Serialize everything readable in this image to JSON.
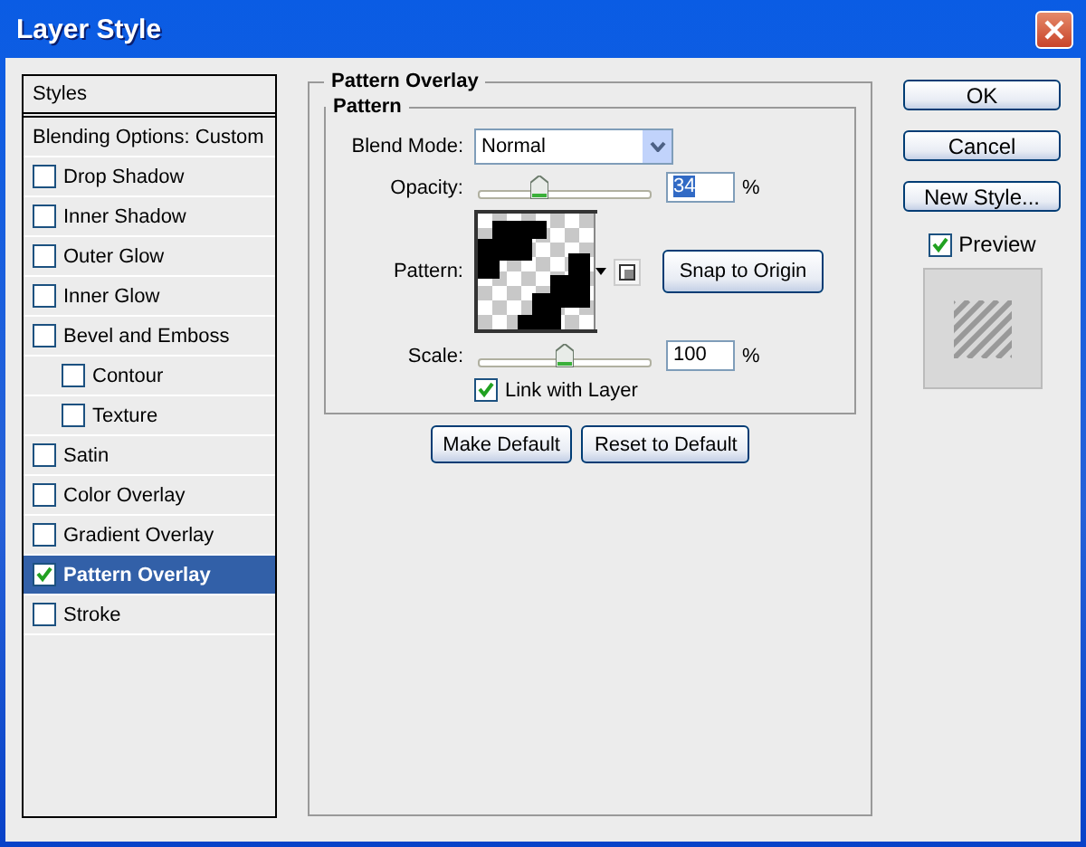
{
  "window": {
    "title": "Layer Style"
  },
  "styles_list": {
    "header": "Styles",
    "blending": "Blending Options: Custom",
    "items": [
      {
        "label": "Drop Shadow",
        "checked": false,
        "selected": false
      },
      {
        "label": "Inner Shadow",
        "checked": false,
        "selected": false
      },
      {
        "label": "Outer Glow",
        "checked": false,
        "selected": false
      },
      {
        "label": "Inner Glow",
        "checked": false,
        "selected": false
      },
      {
        "label": "Bevel and Emboss",
        "checked": false,
        "selected": false,
        "children": [
          {
            "label": "Contour",
            "checked": false,
            "selected": false
          },
          {
            "label": "Texture",
            "checked": false,
            "selected": false
          }
        ]
      },
      {
        "label": "Satin",
        "checked": false,
        "selected": false
      },
      {
        "label": "Color Overlay",
        "checked": false,
        "selected": false
      },
      {
        "label": "Gradient Overlay",
        "checked": false,
        "selected": false
      },
      {
        "label": "Pattern Overlay",
        "checked": true,
        "selected": true
      },
      {
        "label": "Stroke",
        "checked": false,
        "selected": false
      }
    ]
  },
  "panel": {
    "title": "Pattern Overlay",
    "group": "Pattern",
    "blend_mode": {
      "label": "Blend Mode:",
      "value": "Normal"
    },
    "opacity": {
      "label": "Opacity:",
      "level": 0.34,
      "value": "34",
      "unit": "%"
    },
    "pattern": {
      "label": "Pattern:",
      "snap_button": "Snap to Origin"
    },
    "scale": {
      "label": "Scale:",
      "level": 0.5,
      "value": "100",
      "unit": "%"
    },
    "link_with_layer": {
      "label": "Link with Layer",
      "checked": true
    },
    "buttons": [
      "Make Default",
      "Reset to Default"
    ]
  },
  "actions": [
    "OK",
    "Cancel",
    "New Style..."
  ],
  "preview": {
    "label": "Preview",
    "checked": true
  }
}
